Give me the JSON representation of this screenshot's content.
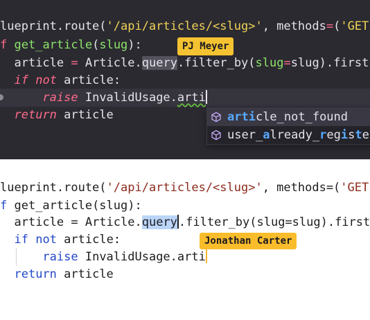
{
  "colors": {
    "dark_background": "#2b2a31",
    "dark_keyword": "#ff6b8b",
    "dark_function": "#8ee46a",
    "dark_string": "#f0d257",
    "autocomplete_match": "#58a9ff",
    "collab_tag": "#f5c331",
    "light_keyword": "#2448c9",
    "light_string": "#8c2c1d",
    "selection": "#bad5f8"
  },
  "dark_editor": {
    "line1": {
      "part1": "lueprint.route(",
      "str1": "'/api/articles/<slug>'",
      "part2": ", methods",
      "op": "=",
      "part3": "(",
      "str2": "'GET'"
    },
    "line2": {
      "kw_def": "f",
      "fn_name": "get_article",
      "part_open": "(",
      "param": "slug",
      "part_close": "):"
    },
    "line3": {
      "indent": "  ",
      "var": "article",
      "eq": " = ",
      "cls": "Article.",
      "hl": "query",
      "part1": ".filter_by(",
      "kwarg": "slug",
      "op": "=",
      "part2": "slug).first"
    },
    "line4": {
      "indent": "  ",
      "kw_if": "if",
      "sp1": " ",
      "kw_not": "not",
      "rest": " article:"
    },
    "line5": {
      "indent": "      ",
      "kw_raise": "raise",
      "rest": " InvalidUsage.",
      "typed": "arti"
    },
    "line6": {
      "indent": "  ",
      "kw_return": "return",
      "rest": " article"
    },
    "collaborator": "PJ Meyer",
    "cube_icon": "method-cube-icon",
    "suggestions": [
      {
        "match1": "arti",
        "rest1": "cle_not_found",
        "m2": "",
        "r2": "",
        "m3": "",
        "r3": "",
        "m4": "",
        "r4": "",
        "m5": "",
        "r5": ""
      },
      {
        "match1": "",
        "rest1": "user_",
        "m2": "a",
        "r2": "lready_",
        "m3": "r",
        "r3": "eg",
        "m4": "i",
        "r4": "s",
        "m5": "t",
        "r5": "e"
      }
    ]
  },
  "light_editor": {
    "line1": {
      "part1": "lueprint.route(",
      "str1": "'/api/articles/<slug>'",
      "part2": ", methods=(",
      "str2": "'GET'"
    },
    "line2": {
      "kw_def": "f",
      "rest": " get_article(slug):"
    },
    "line3": {
      "indent": "  ",
      "part1": "article = Article.",
      "sel": "query",
      "part2": ".filter_by(slug=slug).first("
    },
    "line4": {
      "indent": "  ",
      "kw_if": "if",
      "sp1": " ",
      "kw_not": "not",
      "rest": " article:"
    },
    "line5": {
      "indent": "      ",
      "kw_raise": "raise",
      "rest": " InvalidUsage.",
      "typed": "arti"
    },
    "line6": {
      "indent": "  ",
      "kw_return": "return",
      "rest": " article"
    },
    "collaborator": "Jonathan Carter"
  }
}
